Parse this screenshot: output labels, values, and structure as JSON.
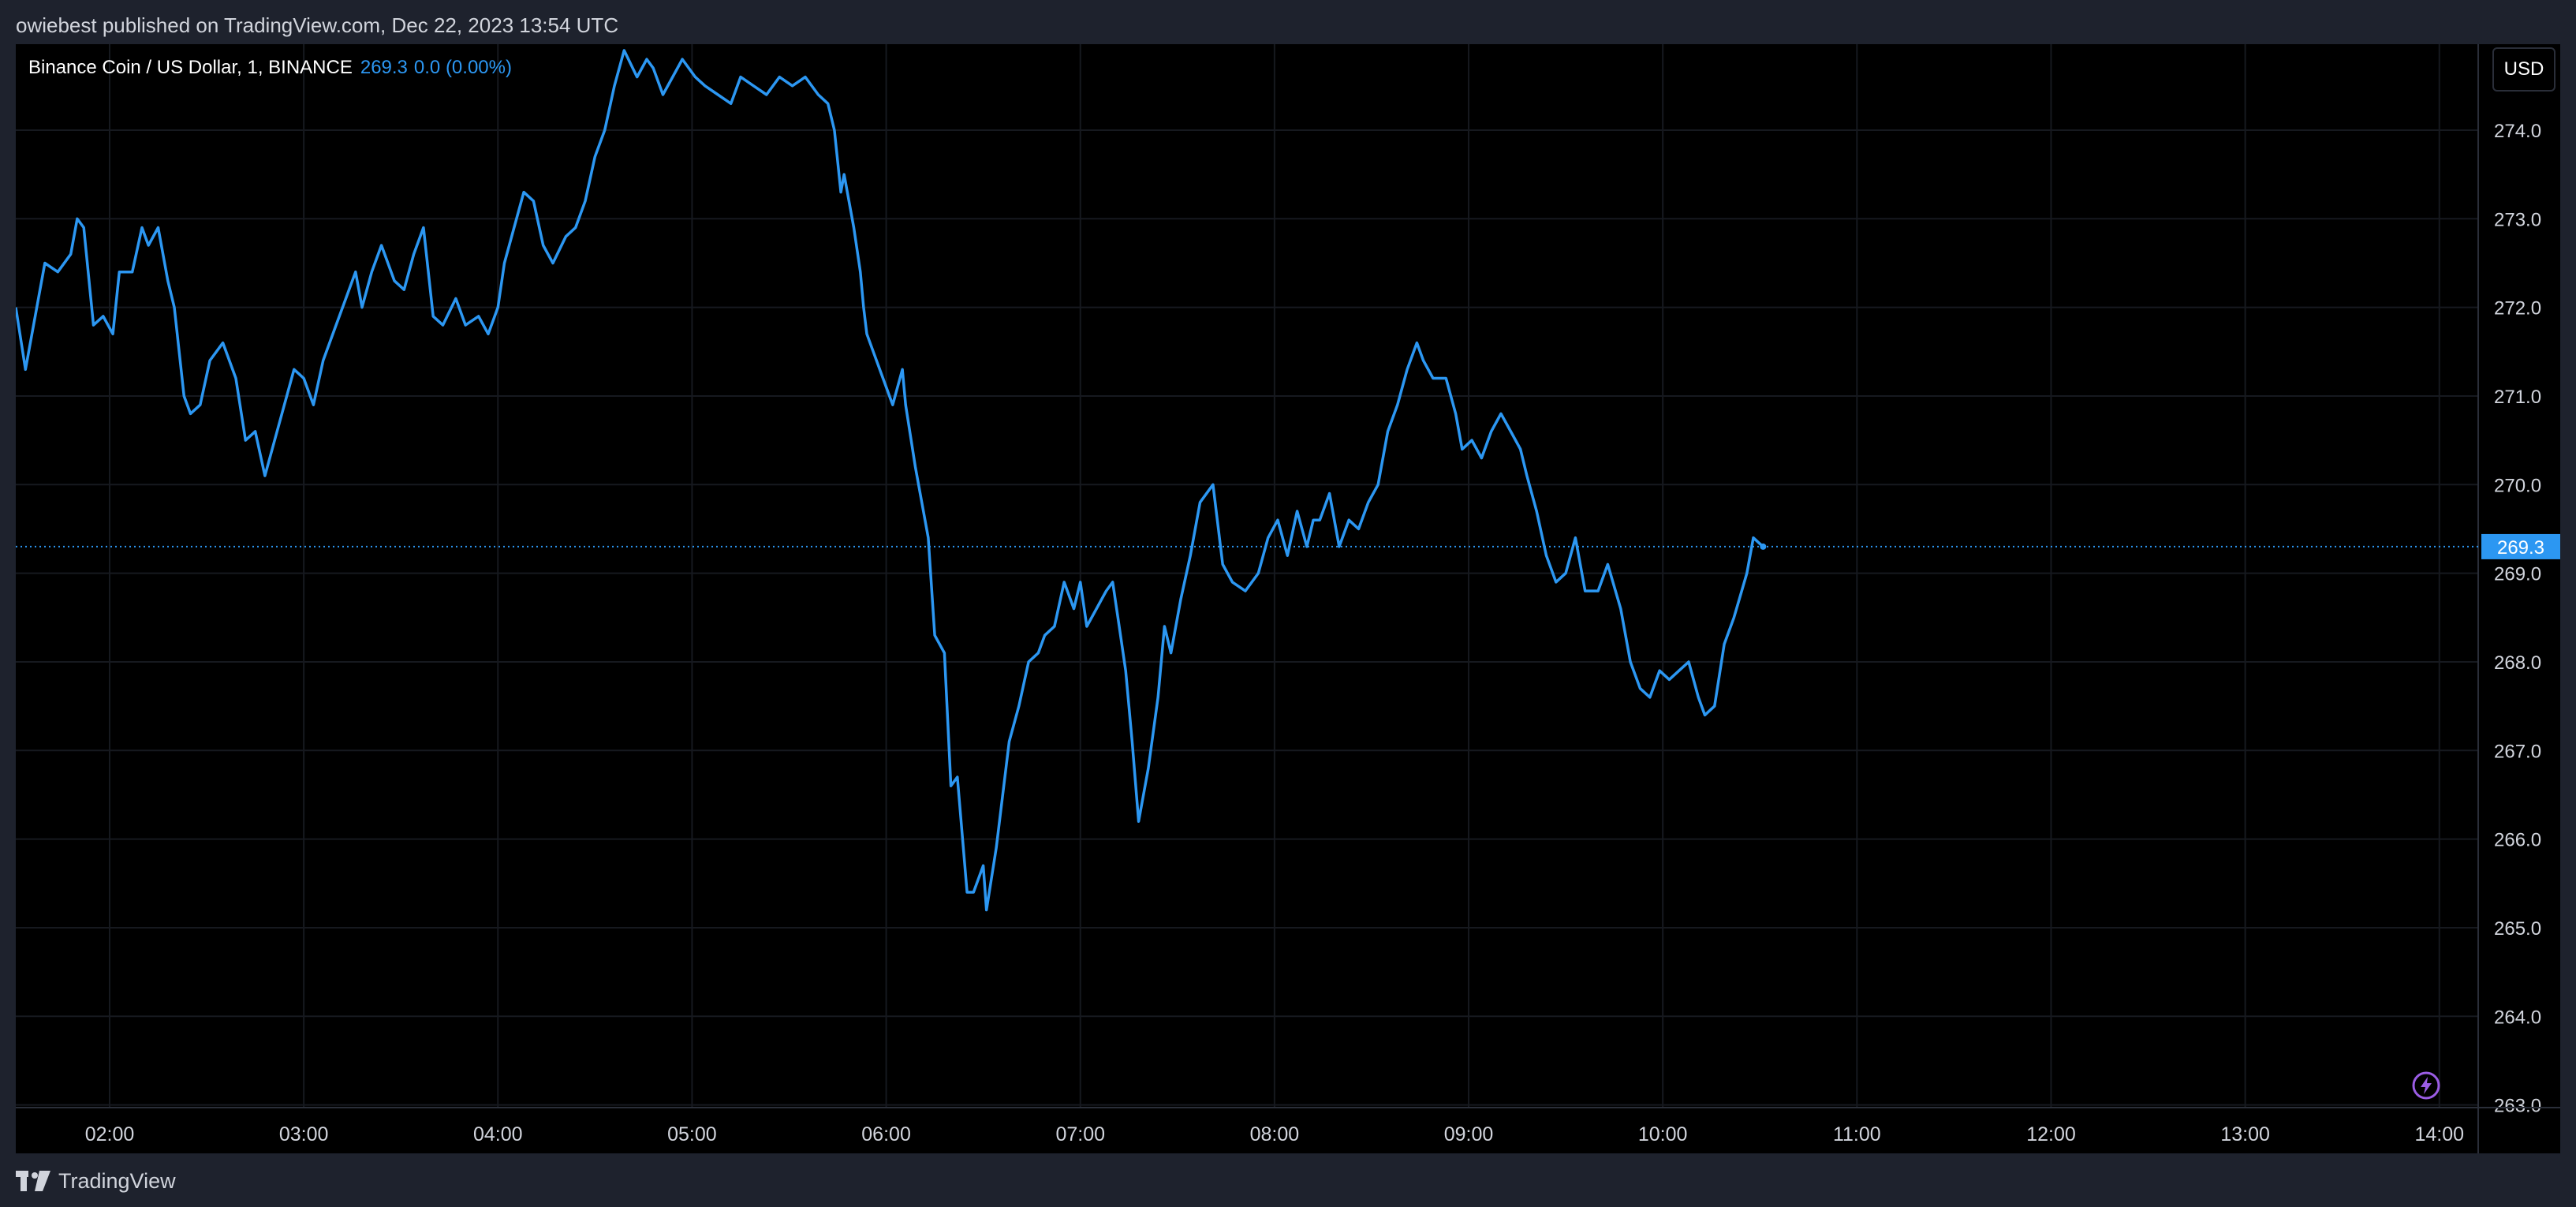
{
  "header": {
    "publisher_text": "owiebest published on TradingView.com, Dec 22, 2023 13:54 UTC"
  },
  "legend": {
    "symbol": "Binance Coin / US Dollar, 1, BINANCE",
    "last_value": "269.3",
    "change": "0.0 (0.00%)"
  },
  "currency_button": "USD",
  "footer": {
    "brand": "TradingView"
  },
  "colors": {
    "line": "#2c97f2",
    "background": "#000000",
    "grid": "#16191f",
    "axis_text": "#d1d4dc",
    "price_label_bg": "#2c97f2"
  },
  "chart_data": {
    "type": "line",
    "title": "",
    "xlabel": "",
    "ylabel": "",
    "ylim": [
      262.97,
      274.97
    ],
    "xlim": [
      "01:31",
      "14:12"
    ],
    "grid": true,
    "y_ticks": [
      "274.0",
      "273.0",
      "272.0",
      "271.0",
      "270.0",
      "269.0",
      "268.0",
      "267.0",
      "266.0",
      "265.0",
      "264.0",
      "263.0"
    ],
    "x_ticks": [
      "02:00",
      "03:00",
      "04:00",
      "05:00",
      "06:00",
      "07:00",
      "08:00",
      "09:00",
      "10:00",
      "11:00",
      "12:00",
      "13:00",
      "14:00"
    ],
    "last_price": 269.3,
    "last_price_label": "269.3",
    "series": [
      {
        "values": [
          [
            "01:31",
            272.0
          ],
          [
            "01:34",
            271.3
          ],
          [
            "01:37",
            271.9
          ],
          [
            "01:40",
            272.5
          ],
          [
            "01:44",
            272.4
          ],
          [
            "01:48",
            272.6
          ],
          [
            "01:50",
            273.0
          ],
          [
            "01:52",
            272.9
          ],
          [
            "01:55",
            271.8
          ],
          [
            "01:58",
            271.9
          ],
          [
            "02:01",
            271.7
          ],
          [
            "02:03",
            272.4
          ],
          [
            "02:07",
            272.4
          ],
          [
            "02:10",
            272.9
          ],
          [
            "02:12",
            272.7
          ],
          [
            "02:15",
            272.9
          ],
          [
            "02:18",
            272.3
          ],
          [
            "02:20",
            272.0
          ],
          [
            "02:23",
            271.0
          ],
          [
            "02:25",
            270.8
          ],
          [
            "02:28",
            270.9
          ],
          [
            "02:31",
            271.4
          ],
          [
            "02:35",
            271.6
          ],
          [
            "02:39",
            271.2
          ],
          [
            "02:42",
            270.5
          ],
          [
            "02:45",
            270.6
          ],
          [
            "02:48",
            270.1
          ],
          [
            "02:51",
            270.5
          ],
          [
            "02:54",
            270.9
          ],
          [
            "02:57",
            271.3
          ],
          [
            "03:00",
            271.2
          ],
          [
            "03:03",
            270.9
          ],
          [
            "03:06",
            271.4
          ],
          [
            "03:10",
            271.8
          ],
          [
            "03:13",
            272.1
          ],
          [
            "03:16",
            272.4
          ],
          [
            "03:18",
            272.0
          ],
          [
            "03:21",
            272.4
          ],
          [
            "03:24",
            272.7
          ],
          [
            "03:28",
            272.3
          ],
          [
            "03:31",
            272.2
          ],
          [
            "03:34",
            272.6
          ],
          [
            "03:37",
            272.9
          ],
          [
            "03:40",
            271.9
          ],
          [
            "03:43",
            271.8
          ],
          [
            "03:47",
            272.1
          ],
          [
            "03:50",
            271.8
          ],
          [
            "03:54",
            271.9
          ],
          [
            "03:57",
            271.7
          ],
          [
            "04:00",
            272.0
          ],
          [
            "04:02",
            272.5
          ],
          [
            "04:05",
            272.9
          ],
          [
            "04:08",
            273.3
          ],
          [
            "04:11",
            273.2
          ],
          [
            "04:14",
            272.7
          ],
          [
            "04:17",
            272.5
          ],
          [
            "04:21",
            272.8
          ],
          [
            "04:24",
            272.9
          ],
          [
            "04:27",
            273.2
          ],
          [
            "04:30",
            273.7
          ],
          [
            "04:33",
            274.0
          ],
          [
            "04:36",
            274.5
          ],
          [
            "04:39",
            274.9
          ],
          [
            "04:43",
            274.6
          ],
          [
            "04:46",
            274.8
          ],
          [
            "04:48",
            274.7
          ],
          [
            "04:51",
            274.4
          ],
          [
            "04:54",
            274.6
          ],
          [
            "04:57",
            274.8
          ],
          [
            "05:01",
            274.6
          ],
          [
            "05:04",
            274.5
          ],
          [
            "05:08",
            274.4
          ],
          [
            "05:12",
            274.3
          ],
          [
            "05:15",
            274.6
          ],
          [
            "05:19",
            274.5
          ],
          [
            "05:23",
            274.4
          ],
          [
            "05:27",
            274.6
          ],
          [
            "05:31",
            274.5
          ],
          [
            "05:35",
            274.6
          ],
          [
            "05:39",
            274.4
          ],
          [
            "05:42",
            274.3
          ],
          [
            "05:44",
            274.0
          ],
          [
            "05:46",
            273.3
          ],
          [
            "05:47",
            273.5
          ],
          [
            "05:49",
            273.1
          ],
          [
            "05:50",
            272.9
          ],
          [
            "05:52",
            272.4
          ],
          [
            "05:53",
            272.0
          ],
          [
            "05:54",
            271.7
          ],
          [
            "05:56",
            271.5
          ],
          [
            "05:59",
            271.2
          ],
          [
            "06:02",
            270.9
          ],
          [
            "06:05",
            271.3
          ],
          [
            "06:06",
            270.9
          ],
          [
            "06:09",
            270.2
          ],
          [
            "06:13",
            269.4
          ],
          [
            "06:15",
            268.3
          ],
          [
            "06:18",
            268.1
          ],
          [
            "06:20",
            266.6
          ],
          [
            "06:22",
            266.7
          ],
          [
            "06:25",
            265.4
          ],
          [
            "06:27",
            265.4
          ],
          [
            "06:30",
            265.7
          ],
          [
            "06:31",
            265.2
          ],
          [
            "06:34",
            265.9
          ],
          [
            "06:36",
            266.5
          ],
          [
            "06:38",
            267.1
          ],
          [
            "06:41",
            267.5
          ],
          [
            "06:44",
            268.0
          ],
          [
            "06:47",
            268.1
          ],
          [
            "06:49",
            268.3
          ],
          [
            "06:52",
            268.4
          ],
          [
            "06:55",
            268.9
          ],
          [
            "06:58",
            268.6
          ],
          [
            "07:00",
            268.9
          ],
          [
            "07:02",
            268.4
          ],
          [
            "07:05",
            268.6
          ],
          [
            "07:08",
            268.8
          ],
          [
            "07:10",
            268.9
          ],
          [
            "07:12",
            268.4
          ],
          [
            "07:14",
            267.9
          ],
          [
            "07:16",
            267.1
          ],
          [
            "07:18",
            266.2
          ],
          [
            "07:21",
            266.8
          ],
          [
            "07:24",
            267.6
          ],
          [
            "07:26",
            268.4
          ],
          [
            "07:28",
            268.1
          ],
          [
            "07:31",
            268.7
          ],
          [
            "07:34",
            269.2
          ],
          [
            "07:37",
            269.8
          ],
          [
            "07:41",
            270.0
          ],
          [
            "07:44",
            269.1
          ],
          [
            "07:47",
            268.9
          ],
          [
            "07:51",
            268.8
          ],
          [
            "07:55",
            269.0
          ],
          [
            "07:58",
            269.4
          ],
          [
            "08:01",
            269.6
          ],
          [
            "08:04",
            269.2
          ],
          [
            "08:07",
            269.7
          ],
          [
            "08:10",
            269.3
          ],
          [
            "08:12",
            269.6
          ],
          [
            "08:14",
            269.6
          ],
          [
            "08:17",
            269.9
          ],
          [
            "08:20",
            269.3
          ],
          [
            "08:23",
            269.6
          ],
          [
            "08:26",
            269.5
          ],
          [
            "08:29",
            269.8
          ],
          [
            "08:32",
            270.0
          ],
          [
            "08:35",
            270.6
          ],
          [
            "08:38",
            270.9
          ],
          [
            "08:41",
            271.3
          ],
          [
            "08:44",
            271.6
          ],
          [
            "08:46",
            271.4
          ],
          [
            "08:49",
            271.2
          ],
          [
            "08:53",
            271.2
          ],
          [
            "08:56",
            270.8
          ],
          [
            "08:58",
            270.4
          ],
          [
            "09:01",
            270.5
          ],
          [
            "09:04",
            270.3
          ],
          [
            "09:07",
            270.6
          ],
          [
            "09:10",
            270.8
          ],
          [
            "09:13",
            270.6
          ],
          [
            "09:16",
            270.4
          ],
          [
            "09:18",
            270.1
          ],
          [
            "09:21",
            269.7
          ],
          [
            "09:24",
            269.2
          ],
          [
            "09:27",
            268.9
          ],
          [
            "09:30",
            269.0
          ],
          [
            "09:33",
            269.4
          ],
          [
            "09:36",
            268.8
          ],
          [
            "09:40",
            268.8
          ],
          [
            "09:43",
            269.1
          ],
          [
            "09:47",
            268.6
          ],
          [
            "09:50",
            268.0
          ],
          [
            "09:53",
            267.7
          ],
          [
            "09:56",
            267.6
          ],
          [
            "09:59",
            267.9
          ],
          [
            "10:02",
            267.8
          ],
          [
            "10:05",
            267.9
          ],
          [
            "10:08",
            268.0
          ],
          [
            "10:11",
            267.6
          ],
          [
            "10:13",
            267.4
          ],
          [
            "10:16",
            267.5
          ],
          [
            "10:19",
            268.2
          ],
          [
            "10:22",
            268.5
          ],
          [
            "10:26",
            269.0
          ],
          [
            "10:28",
            269.4
          ],
          [
            "10:31",
            269.3
          ]
        ]
      }
    ]
  }
}
